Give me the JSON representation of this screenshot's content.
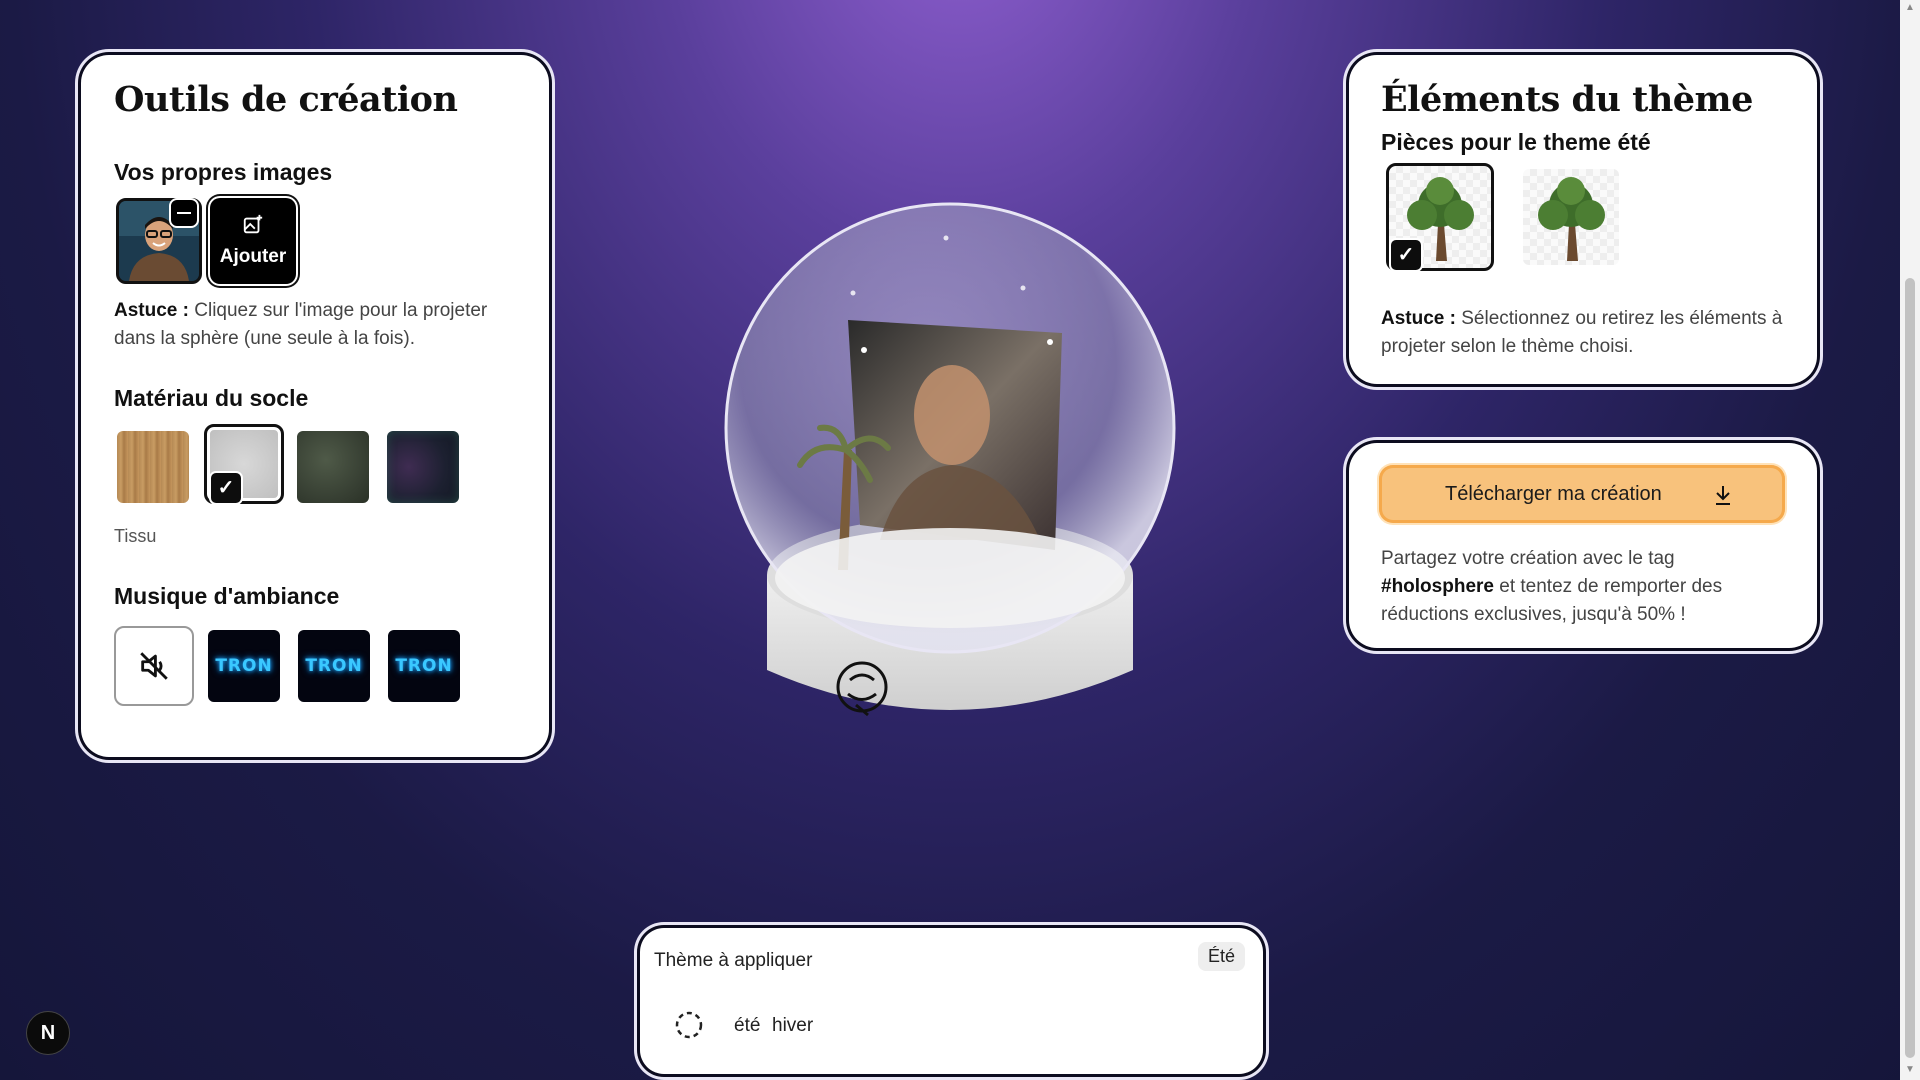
{
  "left_panel": {
    "title": "Outils de création",
    "own_images": {
      "heading": "Vos propres images",
      "add_label": "Ajouter",
      "tip_bold": "Astuce :",
      "tip_text": " Cliquez sur l'image pour la projeter dans la sphère (une seule à la fois)."
    },
    "base_material": {
      "heading": "Matériau du socle",
      "selected_name": "Tissu",
      "swatches": [
        "wood",
        "fabric",
        "moss",
        "dark-neon"
      ]
    },
    "music": {
      "heading": "Musique d'ambiance",
      "tracks": [
        "TRON",
        "TRON",
        "TRON"
      ]
    }
  },
  "right_panel": {
    "title": "Éléments du thème",
    "subtitle": "Pièces pour le theme été",
    "tip_bold": "Astuce :",
    "tip_text": " Sélectionnez ou retirez les éléments à projeter selon le thème choisi."
  },
  "download_panel": {
    "button_label": "Télécharger ma création",
    "share_text_1": "Partagez votre création avec le tag ",
    "share_tag": "#holosphere",
    "share_text_2": " et tentez de remporter des réductions exclusives, jusqu'à 50% !"
  },
  "theme_panel": {
    "label": "Thème à appliquer",
    "current_badge": "Été",
    "options": [
      "été",
      "hiver"
    ]
  },
  "dev_badge": "N",
  "colors": {
    "accent_orange": "#f8c27c",
    "background_top": "#8f5fd0",
    "background_bottom": "#15163a"
  }
}
